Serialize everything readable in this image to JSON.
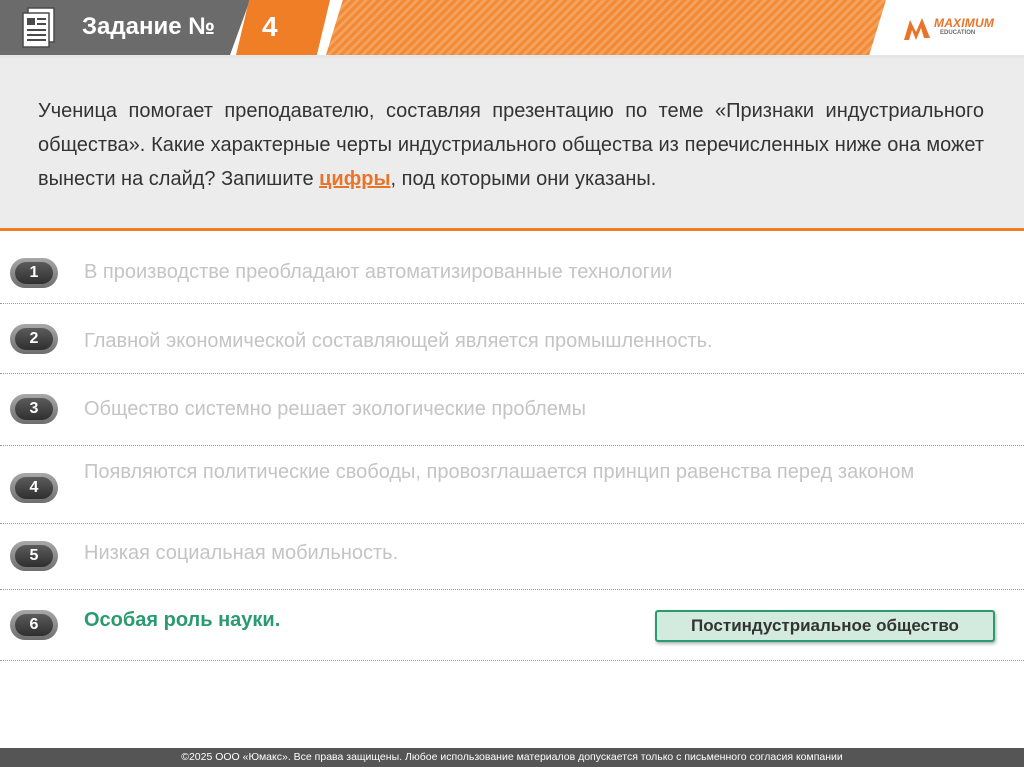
{
  "header": {
    "task_label": "Задание №",
    "task_number": "4",
    "logo_title": "MAXIMUM",
    "logo_subtitle": "EDUCATION",
    "accent_color": "#f07e26"
  },
  "question": {
    "text_before": "Ученица помогает преподавателю, составляя презентацию по теме «Признаки индустриального общества». Какие характерные черты индустриального общества из перечисленных ниже она может вынести на слайд? Запишите ",
    "highlight": "цифры",
    "text_after": ", под которыми они указаны."
  },
  "options": [
    {
      "number": "1",
      "text": "В производстве преобладают автоматизированные технологии"
    },
    {
      "number": "2",
      "text": "Главной экономической составляющей является промышленность."
    },
    {
      "number": "3",
      "text": "Общество системно решает экологические проблемы"
    },
    {
      "number": "4",
      "text": "Появляются политические свободы, провозглашается принцип равенства перед законом"
    },
    {
      "number": "5",
      "text": "Низкая социальная мобильность."
    },
    {
      "number": "6",
      "text": "Особая роль науки."
    }
  ],
  "tag": "Постиндустриальное общество",
  "footer": "©2025 ООО «Юмакс». Все права защищены. Любое использование материалов допускается только с  письменного согласия компании"
}
